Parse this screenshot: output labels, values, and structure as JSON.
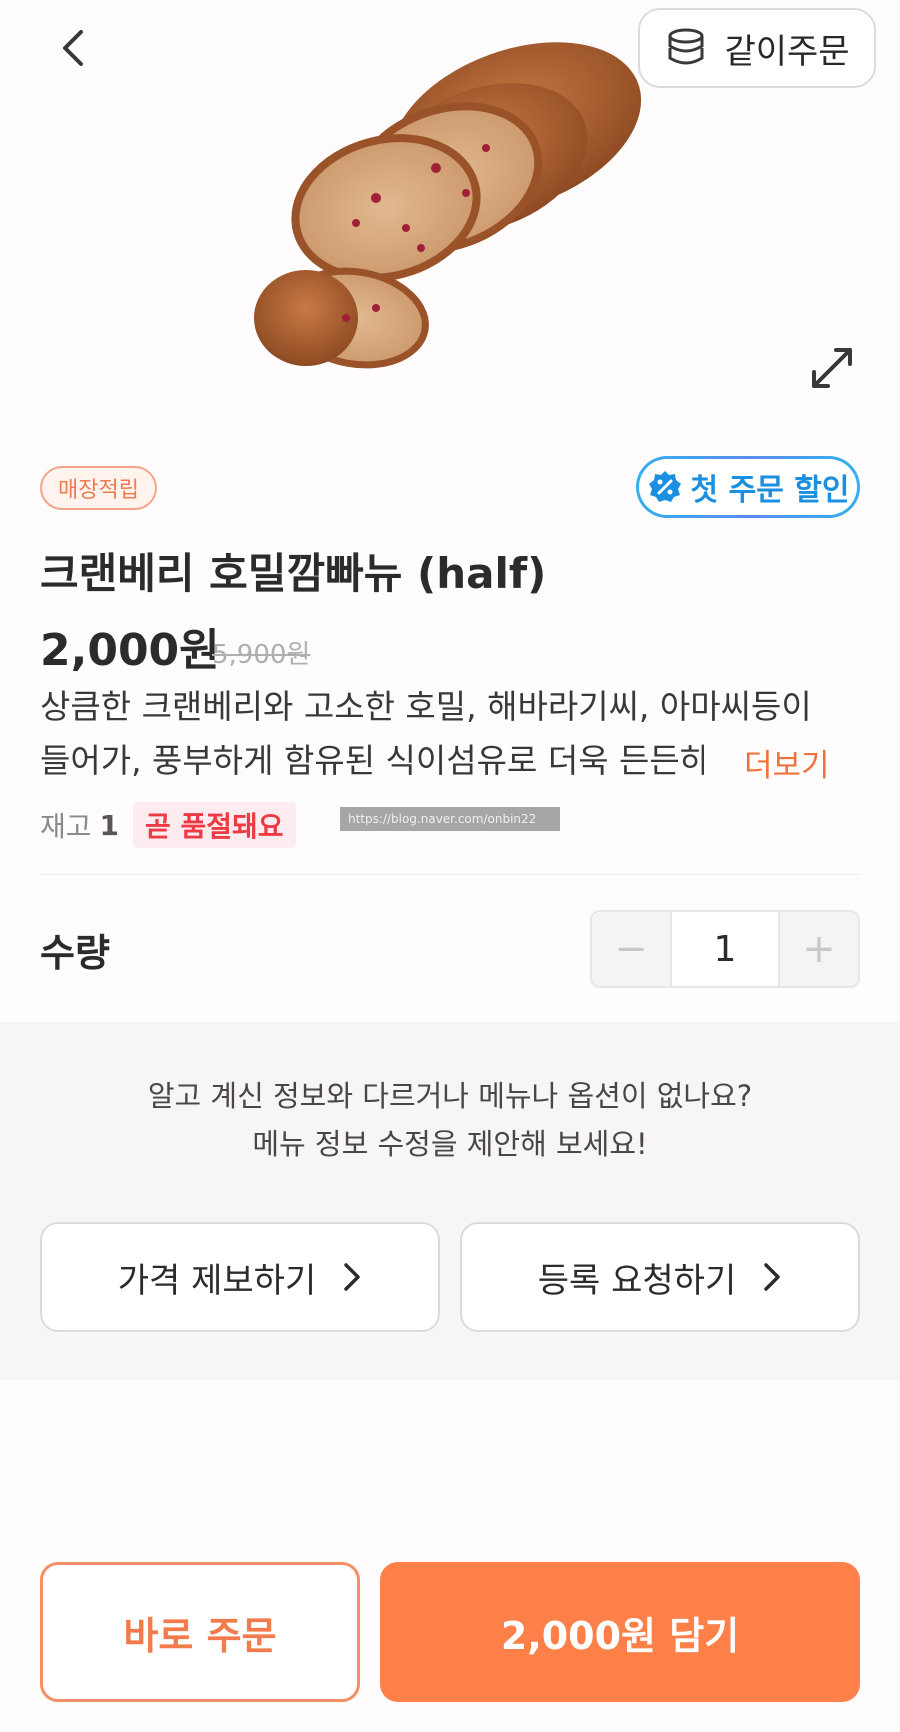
{
  "header": {
    "group_order_label": "같이주문"
  },
  "product": {
    "store_badge": "매장적립",
    "discount_badge": "첫 주문 할인",
    "title": "크랜베리 호밀깜빠뉴 (half)",
    "price": "2,000원",
    "original_price": "5,900원",
    "description_line1": "상큼한 크랜베리와 고소한 호밀, 해바라기씨, 아마씨등이",
    "description_line2": "들어가, 풍부하게 함유된 식이섬유로 더욱 든든하",
    "more_label": "더보기",
    "stock_label": "재고",
    "stock_count": "1",
    "soldout_badge": "곧 품절돼요",
    "watermark": "https://blog.naver.com/onbin22"
  },
  "quantity": {
    "label": "수량",
    "value": "1",
    "minus": "−",
    "plus": "+"
  },
  "suggest": {
    "line1": "알고 계신 정보와 다르거나 메뉴나 옵션이 없나요?",
    "line2": "메뉴 정보 수정을 제안해 보세요!",
    "price_report_label": "가격 제보하기",
    "register_request_label": "등록 요청하기"
  },
  "footer": {
    "order_now_label": "바로 주문",
    "add_cart_label": "2,000원 담기"
  },
  "colors": {
    "accent": "#fe8049",
    "soldout": "#ed3b46",
    "discount": "#1b8fe0"
  }
}
